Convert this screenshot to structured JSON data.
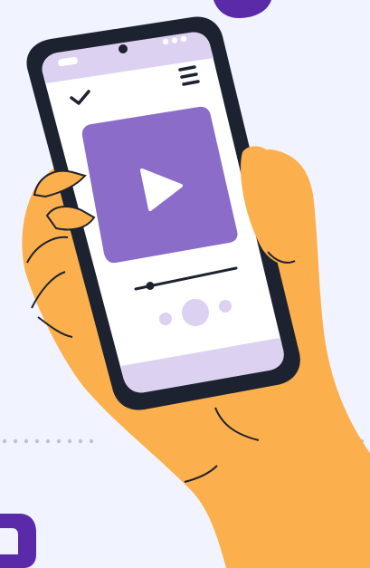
{
  "colors": {
    "background": "#f1f4fe",
    "accent": "#8b6cc9",
    "accent_light": "#dcd1f1",
    "device_frame": "#1d2230",
    "skin": "#fcb04d",
    "brand_dark": "#5a2aa8",
    "dots": "#bcc2d8"
  },
  "illustration": {
    "subject": "hand-holding-phone",
    "screen": {
      "icons": [
        "check-icon",
        "menu-icon",
        "play-icon",
        "camera-icon",
        "more-dots-icon"
      ],
      "media_player": {
        "progress": 0.12
      }
    }
  }
}
